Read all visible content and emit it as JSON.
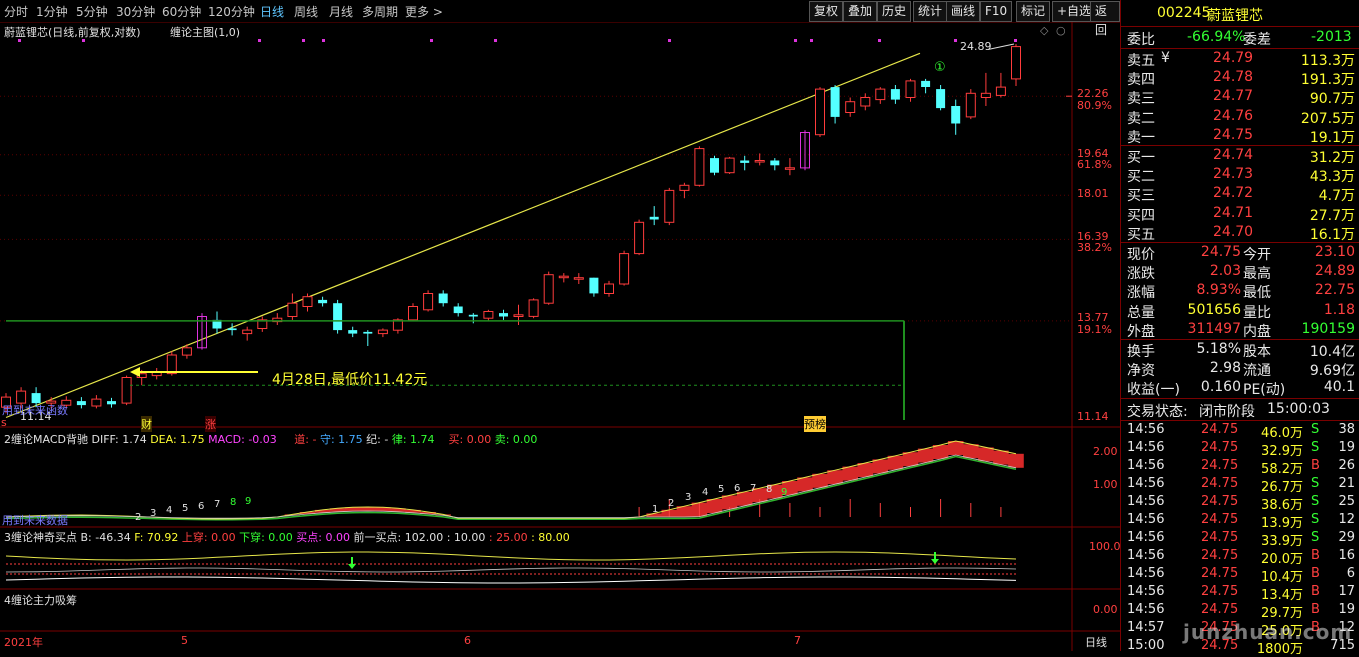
{
  "toolbar": {
    "timeframes": [
      "分时",
      "1分钟",
      "5分钟",
      "30分钟",
      "60分钟",
      "120分钟",
      "日线",
      "周线",
      "月线",
      "多周期",
      "更多 >"
    ],
    "active_timeframe": "日线",
    "buttons": [
      "复权",
      "叠加",
      "历史",
      "统计",
      "画线",
      "F10",
      "标记",
      "+自选",
      "返回"
    ]
  },
  "main_chart": {
    "title": "蔚蓝锂芯(日线,前复权,对数)",
    "indicator": "缠论主图(1,0)",
    "price_labels": [
      "22.26",
      "80.9%",
      "19.64",
      "61.8%",
      "18.01",
      "16.39",
      "38.2%",
      "13.77",
      "19.1%",
      "11.14"
    ],
    "high_label": "24.89",
    "low_label": "11.14",
    "circle_marker": "①",
    "annotation": "4月28日,最低价11.42元",
    "bottom_left_text": "用到未来函数",
    "markers": {
      "s": "s",
      "cai": "财",
      "zhang": "涨",
      "yubang": "预榜"
    }
  },
  "macd_panel": {
    "name": "2缠论MACD背驰",
    "diff_label": "DIFF: 1.74",
    "dea_label": "DEA: 1.75",
    "macd_label": "MACD: -0.03",
    "dao_label": "道: -",
    "shou_label": "守: 1.75",
    "ji_label": "纪: -",
    "lv_label": "律: 1.74",
    "buy_label": "买: 0.00",
    "sell_label": "卖: 0.00",
    "axis": [
      "2.00",
      "1.00"
    ],
    "bottom_text": "用到未来数据",
    "counts_left": [
      "2",
      "3",
      "4",
      "5",
      "6",
      "7",
      "8",
      "9"
    ],
    "counts_right": [
      "1",
      "2",
      "3",
      "4",
      "5",
      "6",
      "7",
      "8",
      "9"
    ]
  },
  "buy_panel": {
    "name": "3缠论神奇买点",
    "b_label": "B: -46.34",
    "f_label": "F: 70.92",
    "shangchuan": "上穿: 0.00",
    "xiachuan": "下穿: 0.00",
    "maidian": "买点: 0.00",
    "prev_label": "前一买点: 102.00 : 10.00",
    "v25": ": 25.00",
    "v80": ": 80.00",
    "axis": "100.0"
  },
  "xichou_panel": {
    "name": "4缠论主力吸筹",
    "axis": "0.00"
  },
  "date_axis": {
    "labels": [
      "2021年",
      "5",
      "6",
      "7"
    ],
    "period": "日线"
  },
  "quote": {
    "code": "002245",
    "name": "蔚蓝锂芯",
    "weibi_label": "委比",
    "weibi": "-66.94%",
    "weicha_label": "委差",
    "weicha": "-2013",
    "asks": [
      {
        "label": "卖五",
        "price": "24.79",
        "vol": "113.3万",
        "mark": "¥"
      },
      {
        "label": "卖四",
        "price": "24.78",
        "vol": "191.3万",
        "mark": ""
      },
      {
        "label": "卖三",
        "price": "24.77",
        "vol": "90.7万",
        "mark": ""
      },
      {
        "label": "卖二",
        "price": "24.76",
        "vol": "207.5万",
        "mark": ""
      },
      {
        "label": "卖一",
        "price": "24.75",
        "vol": "19.1万",
        "mark": ""
      }
    ],
    "bids": [
      {
        "label": "买一",
        "price": "24.74",
        "vol": "31.2万"
      },
      {
        "label": "买二",
        "price": "24.73",
        "vol": "43.3万"
      },
      {
        "label": "买三",
        "price": "24.72",
        "vol": "4.7万"
      },
      {
        "label": "买四",
        "price": "24.71",
        "vol": "27.7万"
      },
      {
        "label": "买五",
        "price": "24.70",
        "vol": "16.1万"
      }
    ],
    "stats1": [
      {
        "l1": "现价",
        "v1": "24.75",
        "l2": "今开",
        "v2": "23.10",
        "c1": "red",
        "c2": "red"
      },
      {
        "l1": "涨跌",
        "v1": "2.03",
        "l2": "最高",
        "v2": "24.89",
        "c1": "red",
        "c2": "red"
      },
      {
        "l1": "涨幅",
        "v1": "8.93%",
        "l2": "最低",
        "v2": "22.75",
        "c1": "red",
        "c2": "red"
      },
      {
        "l1": "总量",
        "v1": "501656",
        "l2": "量比",
        "v2": "1.18",
        "c1": "yel",
        "c2": "red"
      },
      {
        "l1": "外盘",
        "v1": "311497",
        "l2": "内盘",
        "v2": "190159",
        "c1": "red",
        "c2": "grn"
      }
    ],
    "stats2": [
      {
        "l1": "换手",
        "v1": "5.18%",
        "l2": "股本",
        "v2": "10.4亿"
      },
      {
        "l1": "净资",
        "v1": "2.98",
        "l2": "流通",
        "v2": "9.69亿"
      },
      {
        "l1": "收益(一)",
        "v1": "0.160",
        "l2": "PE(动)",
        "v2": "40.1"
      }
    ],
    "trade_status_label": "交易状态:",
    "trade_status": "闭市阶段",
    "trade_time": "15:00:03",
    "ticks": [
      {
        "t": "14:56",
        "p": "24.75",
        "v": "46.0万",
        "bs": "S",
        "n": "38"
      },
      {
        "t": "14:56",
        "p": "24.75",
        "v": "32.9万",
        "bs": "S",
        "n": "19"
      },
      {
        "t": "14:56",
        "p": "24.75",
        "v": "58.2万",
        "bs": "B",
        "n": "26"
      },
      {
        "t": "14:56",
        "p": "24.75",
        "v": "26.7万",
        "bs": "S",
        "n": "21"
      },
      {
        "t": "14:56",
        "p": "24.75",
        "v": "38.6万",
        "bs": "S",
        "n": "25"
      },
      {
        "t": "14:56",
        "p": "24.75",
        "v": "13.9万",
        "bs": "S",
        "n": "12"
      },
      {
        "t": "14:56",
        "p": "24.75",
        "v": "33.9万",
        "bs": "S",
        "n": "29"
      },
      {
        "t": "14:56",
        "p": "24.75",
        "v": "20.0万",
        "bs": "B",
        "n": "16"
      },
      {
        "t": "14:56",
        "p": "24.75",
        "v": "10.4万",
        "bs": "B",
        "n": "6"
      },
      {
        "t": "14:56",
        "p": "24.75",
        "v": "13.4万",
        "bs": "B",
        "n": "17"
      },
      {
        "t": "14:56",
        "p": "24.75",
        "v": "29.7万",
        "bs": "B",
        "n": "19"
      },
      {
        "t": "14:57",
        "p": "24.75",
        "v": "25.0万",
        "bs": "B",
        "n": "12"
      },
      {
        "t": "15:00",
        "p": "24.75",
        "v": "1800万",
        "bs": "",
        "n": "715"
      }
    ],
    "watermark": "junzhuan.com"
  },
  "candles": [
    {
      "o": 11.45,
      "c": 11.7,
      "h": 11.8,
      "l": 11.3
    },
    {
      "o": 11.55,
      "c": 11.85,
      "h": 11.95,
      "l": 11.42
    },
    {
      "o": 11.8,
      "c": 11.55,
      "h": 11.95,
      "l": 11.45
    },
    {
      "o": 11.55,
      "c": 11.6,
      "h": 11.7,
      "l": 11.42
    },
    {
      "o": 11.5,
      "c": 11.62,
      "h": 11.72,
      "l": 11.42
    },
    {
      "o": 11.6,
      "c": 11.5,
      "h": 11.7,
      "l": 11.42
    },
    {
      "o": 11.48,
      "c": 11.65,
      "h": 11.75,
      "l": 11.42
    },
    {
      "o": 11.6,
      "c": 11.52,
      "h": 11.68,
      "l": 11.44
    },
    {
      "o": 11.55,
      "c": 12.2,
      "h": 12.25,
      "l": 11.5
    },
    {
      "o": 12.2,
      "c": 12.3,
      "h": 12.4,
      "l": 12.0
    },
    {
      "o": 12.25,
      "c": 12.35,
      "h": 12.45,
      "l": 12.15
    },
    {
      "o": 12.3,
      "c": 12.8,
      "h": 12.9,
      "l": 12.25
    },
    {
      "o": 12.8,
      "c": 13.0,
      "h": 13.1,
      "l": 12.7
    },
    {
      "o": 13.0,
      "c": 13.9,
      "h": 14.0,
      "l": 12.95
    },
    {
      "o": 13.8,
      "c": 13.55,
      "h": 14.05,
      "l": 13.4
    },
    {
      "o": 13.55,
      "c": 13.5,
      "h": 13.7,
      "l": 13.35
    },
    {
      "o": 13.4,
      "c": 13.5,
      "h": 13.6,
      "l": 13.2
    },
    {
      "o": 13.55,
      "c": 13.8,
      "h": 13.9,
      "l": 13.45
    },
    {
      "o": 13.75,
      "c": 13.85,
      "h": 14.0,
      "l": 13.65
    },
    {
      "o": 13.9,
      "c": 14.3,
      "h": 14.6,
      "l": 13.8
    },
    {
      "o": 14.2,
      "c": 14.5,
      "h": 14.6,
      "l": 14.05
    },
    {
      "o": 14.4,
      "c": 14.3,
      "h": 14.5,
      "l": 14.2
    },
    {
      "o": 14.3,
      "c": 13.5,
      "h": 14.4,
      "l": 13.4
    },
    {
      "o": 13.5,
      "c": 13.4,
      "h": 13.6,
      "l": 13.3
    },
    {
      "o": 13.45,
      "c": 13.4,
      "h": 13.5,
      "l": 13.05
    },
    {
      "o": 13.4,
      "c": 13.5,
      "h": 13.55,
      "l": 13.3
    },
    {
      "o": 13.5,
      "c": 13.8,
      "h": 13.85,
      "l": 13.4
    },
    {
      "o": 13.8,
      "c": 14.2,
      "h": 14.3,
      "l": 13.75
    },
    {
      "o": 14.1,
      "c": 14.6,
      "h": 14.7,
      "l": 14.05
    },
    {
      "o": 14.6,
      "c": 14.3,
      "h": 14.7,
      "l": 14.2
    },
    {
      "o": 14.2,
      "c": 14.0,
      "h": 14.3,
      "l": 13.9
    },
    {
      "o": 13.95,
      "c": 13.9,
      "h": 14.0,
      "l": 13.7
    },
    {
      "o": 13.85,
      "c": 14.05,
      "h": 14.1,
      "l": 13.75
    },
    {
      "o": 14.0,
      "c": 13.9,
      "h": 14.1,
      "l": 13.8
    },
    {
      "o": 13.9,
      "c": 13.95,
      "h": 14.25,
      "l": 13.65
    },
    {
      "o": 13.9,
      "c": 14.4,
      "h": 14.45,
      "l": 13.85
    },
    {
      "o": 14.3,
      "c": 15.2,
      "h": 15.3,
      "l": 14.25
    },
    {
      "o": 15.1,
      "c": 15.15,
      "h": 15.25,
      "l": 14.95
    },
    {
      "o": 15.1,
      "c": 15.1,
      "h": 15.25,
      "l": 14.9
    },
    {
      "o": 15.1,
      "c": 14.6,
      "h": 15.1,
      "l": 14.5
    },
    {
      "o": 14.6,
      "c": 14.9,
      "h": 15.0,
      "l": 14.5
    },
    {
      "o": 14.9,
      "c": 15.9,
      "h": 16.0,
      "l": 14.85
    },
    {
      "o": 15.9,
      "c": 17.0,
      "h": 17.1,
      "l": 15.85
    },
    {
      "o": 17.2,
      "c": 17.1,
      "h": 17.6,
      "l": 16.9
    },
    {
      "o": 17.0,
      "c": 18.2,
      "h": 18.3,
      "l": 16.9
    },
    {
      "o": 18.2,
      "c": 18.4,
      "h": 18.5,
      "l": 17.9
    },
    {
      "o": 18.4,
      "c": 19.9,
      "h": 20.0,
      "l": 18.35
    },
    {
      "o": 19.5,
      "c": 18.9,
      "h": 19.6,
      "l": 18.8
    },
    {
      "o": 18.9,
      "c": 19.5,
      "h": 19.55,
      "l": 18.85
    },
    {
      "o": 19.4,
      "c": 19.3,
      "h": 19.6,
      "l": 19.0
    },
    {
      "o": 19.4,
      "c": 19.4,
      "h": 19.7,
      "l": 19.2
    },
    {
      "o": 19.4,
      "c": 19.2,
      "h": 19.5,
      "l": 19.0
    },
    {
      "o": 19.1,
      "c": 19.1,
      "h": 19.5,
      "l": 18.8
    },
    {
      "o": 19.1,
      "c": 20.6,
      "h": 20.7,
      "l": 19.0
    },
    {
      "o": 20.5,
      "c": 22.6,
      "h": 22.7,
      "l": 20.4
    },
    {
      "o": 22.7,
      "c": 21.3,
      "h": 22.8,
      "l": 21.0
    },
    {
      "o": 21.5,
      "c": 22.0,
      "h": 22.2,
      "l": 21.3
    },
    {
      "o": 21.8,
      "c": 22.2,
      "h": 22.4,
      "l": 21.6
    },
    {
      "o": 22.1,
      "c": 22.6,
      "h": 22.7,
      "l": 21.9
    },
    {
      "o": 22.6,
      "c": 22.1,
      "h": 22.8,
      "l": 21.9
    },
    {
      "o": 22.2,
      "c": 23.0,
      "h": 23.1,
      "l": 22.0
    },
    {
      "o": 23.0,
      "c": 22.7,
      "h": 23.1,
      "l": 22.4
    },
    {
      "o": 22.6,
      "c": 21.7,
      "h": 22.8,
      "l": 21.6
    },
    {
      "o": 21.8,
      "c": 21.0,
      "h": 22.1,
      "l": 20.5
    },
    {
      "o": 21.3,
      "c": 22.4,
      "h": 22.6,
      "l": 21.2
    },
    {
      "o": 22.2,
      "c": 22.4,
      "h": 23.4,
      "l": 21.8
    },
    {
      "o": 22.3,
      "c": 22.7,
      "h": 23.4,
      "l": 22.2
    },
    {
      "o": 23.1,
      "c": 24.75,
      "h": 24.89,
      "l": 22.75
    }
  ]
}
